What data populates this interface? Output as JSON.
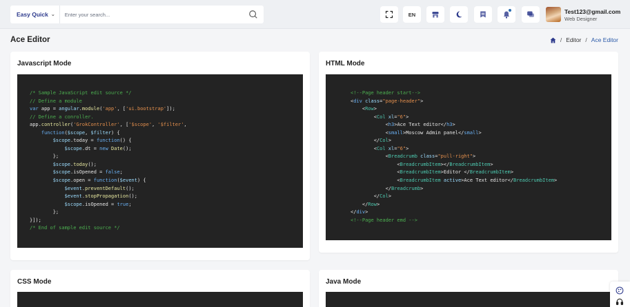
{
  "search": {
    "quick_label": "Easy Quick",
    "placeholder": "Enter your search..."
  },
  "toolbar": {
    "language": "EN"
  },
  "user": {
    "name": "Test123@gmail.com",
    "role": "Web Designer"
  },
  "page": {
    "title": "Ace Editor"
  },
  "breadcrumb": {
    "items": [
      "Editor",
      "Ace Editor"
    ]
  },
  "cards": {
    "js": {
      "title": "Javascript Mode"
    },
    "html": {
      "title": "HTML Mode"
    },
    "css": {
      "title": "CSS Mode"
    },
    "java": {
      "title": "Java Mode"
    }
  },
  "editors": {
    "js": [
      [
        [
          "c",
          "/* Sample JavaScript edit source */"
        ]
      ],
      [
        [
          "c",
          "// Define a module"
        ]
      ],
      [
        [
          "k",
          "var "
        ],
        [
          "tx",
          "app = "
        ],
        [
          "v",
          "angular"
        ],
        [
          "tx",
          "."
        ],
        [
          "f",
          "module"
        ],
        [
          "tx",
          "("
        ],
        [
          "s",
          "'app'"
        ],
        [
          "tx",
          ", ["
        ],
        [
          "s",
          "'ui.bootstrap'"
        ],
        [
          "tx",
          "]);"
        ]
      ],
      [
        [
          "c",
          "// Define a conroller."
        ]
      ],
      [
        [
          "tx",
          "app."
        ],
        [
          "f",
          "controller"
        ],
        [
          "tx",
          "("
        ],
        [
          "s",
          "'GrokController'"
        ],
        [
          "tx",
          ", ["
        ],
        [
          "s",
          "'$scope'"
        ],
        [
          "tx",
          ", "
        ],
        [
          "s",
          "'$filter'"
        ],
        [
          "tx",
          ","
        ]
      ],
      [
        [
          "tx",
          "    "
        ],
        [
          "k",
          "function"
        ],
        [
          "tx",
          "("
        ],
        [
          "v",
          "$scope"
        ],
        [
          "tx",
          ", "
        ],
        [
          "v",
          "$filter"
        ],
        [
          "tx",
          ") {"
        ]
      ],
      [
        [
          "tx",
          "        "
        ],
        [
          "v",
          "$scope"
        ],
        [
          "tx",
          ".today = "
        ],
        [
          "k",
          "function"
        ],
        [
          "tx",
          "() {"
        ]
      ],
      [
        [
          "tx",
          "            "
        ],
        [
          "v",
          "$scope"
        ],
        [
          "tx",
          ".dt = "
        ],
        [
          "k",
          "new "
        ],
        [
          "f",
          "Date"
        ],
        [
          "tx",
          "();"
        ]
      ],
      [
        [
          "tx",
          "        };"
        ]
      ],
      [
        [
          "tx",
          "        "
        ],
        [
          "v",
          "$scope"
        ],
        [
          "tx",
          "."
        ],
        [
          "f",
          "today"
        ],
        [
          "tx",
          "();"
        ]
      ],
      [
        [
          "tx",
          "        "
        ],
        [
          "v",
          "$scope"
        ],
        [
          "tx",
          ".isOpened = "
        ],
        [
          "k",
          "false"
        ],
        [
          "tx",
          ";"
        ]
      ],
      [
        [
          "tx",
          "        "
        ],
        [
          "v",
          "$scope"
        ],
        [
          "tx",
          ".open = "
        ],
        [
          "k",
          "function"
        ],
        [
          "tx",
          "("
        ],
        [
          "v",
          "$event"
        ],
        [
          "tx",
          ") {"
        ]
      ],
      [
        [
          "tx",
          "            "
        ],
        [
          "v",
          "$event"
        ],
        [
          "tx",
          "."
        ],
        [
          "f",
          "preventDefault"
        ],
        [
          "tx",
          "();"
        ]
      ],
      [
        [
          "tx",
          "            "
        ],
        [
          "v",
          "$event"
        ],
        [
          "tx",
          "."
        ],
        [
          "f",
          "stopPropagation"
        ],
        [
          "tx",
          "();"
        ]
      ],
      [
        [
          "tx",
          "            "
        ],
        [
          "v",
          "$scope"
        ],
        [
          "tx",
          ".isOpened = "
        ],
        [
          "k",
          "true"
        ],
        [
          "tx",
          ";"
        ]
      ],
      [
        [
          "tx",
          "        };"
        ]
      ],
      [
        [
          "tx",
          "}]);"
        ]
      ],
      [
        [
          "c",
          "/* End of sample edit source */"
        ]
      ]
    ],
    "html": [
      [
        [
          "c",
          "<!--Page header start-->"
        ]
      ],
      [
        [
          "tx",
          "<"
        ],
        [
          "k",
          "div "
        ],
        [
          "v",
          "class"
        ],
        [
          "tx",
          "="
        ],
        [
          "s",
          "\"page-header\""
        ],
        [
          "tx",
          ">"
        ]
      ],
      [
        [
          "tx",
          "    <"
        ],
        [
          "t",
          "Row"
        ],
        [
          "tx",
          ">"
        ]
      ],
      [
        [
          "tx",
          "        <"
        ],
        [
          "t",
          "Col "
        ],
        [
          "v",
          "xl"
        ],
        [
          "tx",
          "="
        ],
        [
          "s",
          "\"6\""
        ],
        [
          "tx",
          ">"
        ]
      ],
      [
        [
          "tx",
          "            <"
        ],
        [
          "k",
          "h3"
        ],
        [
          "tx",
          ">Ace Text editor</"
        ],
        [
          "k",
          "h3"
        ],
        [
          "tx",
          ">"
        ]
      ],
      [
        [
          "tx",
          "            <"
        ],
        [
          "k",
          "small"
        ],
        [
          "tx",
          ">Moscow Admin panel</"
        ],
        [
          "k",
          "small"
        ],
        [
          "tx",
          ">"
        ]
      ],
      [
        [
          "tx",
          "        </"
        ],
        [
          "t",
          "Col"
        ],
        [
          "tx",
          ">"
        ]
      ],
      [
        [
          "tx",
          "        <"
        ],
        [
          "t",
          "Col "
        ],
        [
          "v",
          "xl"
        ],
        [
          "tx",
          "="
        ],
        [
          "s",
          "\"6\""
        ],
        [
          "tx",
          ">"
        ]
      ],
      [
        [
          "tx",
          "            <"
        ],
        [
          "t",
          "Breadcrumb "
        ],
        [
          "v",
          "class"
        ],
        [
          "tx",
          "="
        ],
        [
          "s",
          "\"pull-right\""
        ],
        [
          "tx",
          ">"
        ]
      ],
      [
        [
          "tx",
          "                <"
        ],
        [
          "t",
          "BreadcrumbItem"
        ],
        [
          "tx",
          "></"
        ],
        [
          "t",
          "BreadcrumbItem"
        ],
        [
          "tx",
          ">"
        ]
      ],
      [
        [
          "tx",
          "                <"
        ],
        [
          "t",
          "BreadcrumbItem"
        ],
        [
          "tx",
          ">Editor </"
        ],
        [
          "t",
          "BreadcrumbItem"
        ],
        [
          "tx",
          ">"
        ]
      ],
      [
        [
          "tx",
          "                <"
        ],
        [
          "t",
          "BreadcrumbItem "
        ],
        [
          "v",
          "active"
        ],
        [
          "tx",
          ">Ace Text editor</"
        ],
        [
          "t",
          "BreadcrumbItem"
        ],
        [
          "tx",
          ">"
        ]
      ],
      [
        [
          "tx",
          "            </"
        ],
        [
          "t",
          "Breadcrumb"
        ],
        [
          "tx",
          ">"
        ]
      ],
      [
        [
          "tx",
          "        </"
        ],
        [
          "t",
          "Col"
        ],
        [
          "tx",
          ">"
        ]
      ],
      [
        [
          "tx",
          "    </"
        ],
        [
          "t",
          "Row"
        ],
        [
          "tx",
          ">"
        ]
      ],
      [
        [
          "tx",
          "</"
        ],
        [
          "k",
          "div"
        ],
        [
          "tx",
          ">"
        ]
      ],
      [
        [
          "c",
          "<!--Page header emd -->"
        ]
      ]
    ]
  },
  "colors": {
    "accent": "#2b5aa8",
    "editor_bg": "#232323",
    "comment": "#4caf50",
    "keyword": "#6ab0f3",
    "string": "#e5904d"
  }
}
